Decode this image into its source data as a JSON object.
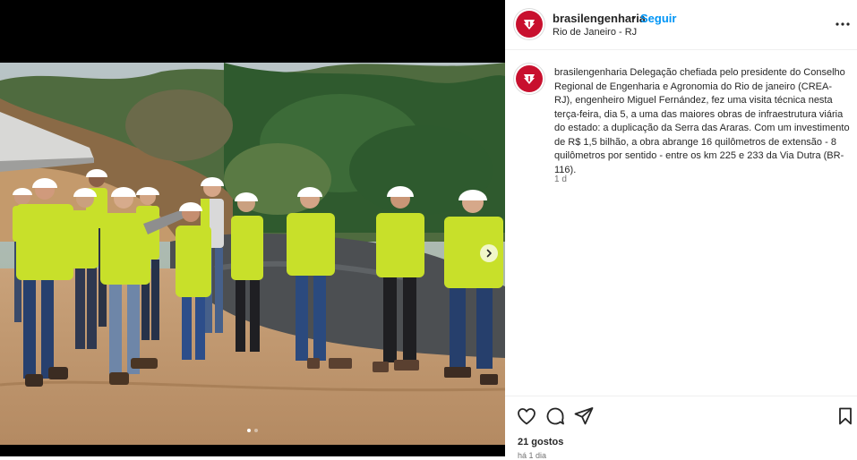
{
  "post": {
    "username": "brasilengenharia",
    "separator": "•",
    "follow_label": "Seguir",
    "location": "Rio de Janeiro - RJ",
    "caption_username": "brasilengenharia",
    "caption_text": "Delegação chefiada pelo presidente do Conselho Regional de Engenharia e Agronomia do Rio de janeiro (CREA-RJ), engenheiro Miguel Fernández, fez uma visita técnica nesta terça-feira, dia 5, a uma das maiores obras de infraestrutura viária do estado: a duplicação da Serra das Araras. Com um investimento de R$ 1,5 bilhão, a obra abrange 16 quilômetros de extensão - 8 quilômetros por sentido - entre os km 225 e 233 da Via Dutra (BR-116).",
    "caption_time": "1 d",
    "likes": "21 gostos",
    "posted_ago": "há 1 dia"
  },
  "carousel": {
    "current": 1,
    "total": 2
  },
  "icons": {
    "more": "more-icon",
    "like": "heart-icon",
    "comment": "comment-icon",
    "share": "share-icon",
    "save": "bookmark-icon",
    "next": "chevron-right-icon"
  },
  "colors": {
    "follow": "#0095f6",
    "avatar": "#c8102e",
    "vest": "#c8e02a",
    "muted": "#737373"
  }
}
